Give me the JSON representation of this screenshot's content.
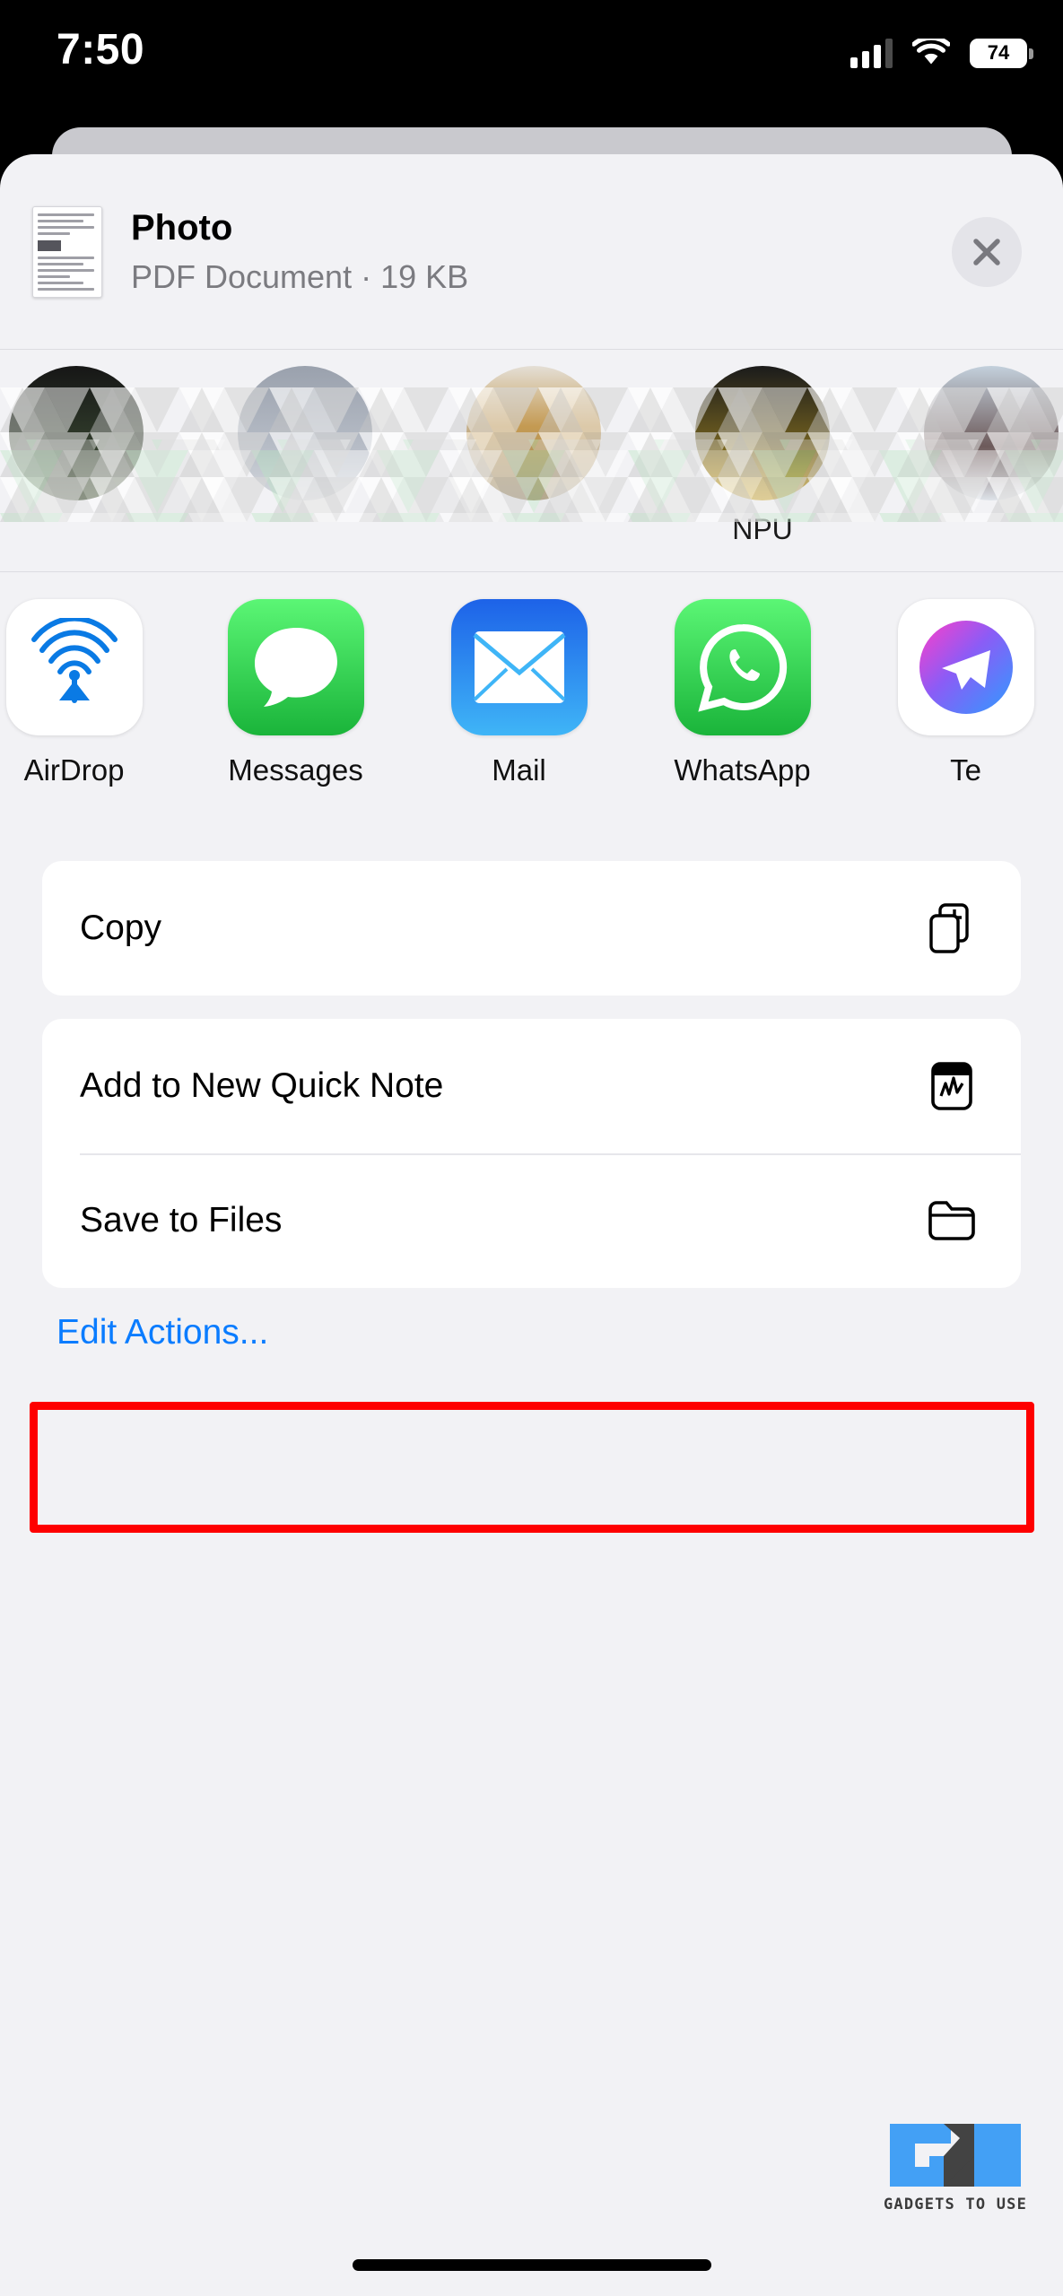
{
  "status_bar": {
    "time": "7:50",
    "battery_level": "74",
    "signal_icon": "cellular-signal-icon",
    "wifi_icon": "wifi-icon",
    "battery_icon": "battery-icon"
  },
  "share_sheet": {
    "document": {
      "title": "Photo",
      "subtitle": "PDF Document · 19 KB",
      "thumbnail_name": "pdf-page-thumbnail"
    },
    "close_label": "Close",
    "contacts": [
      {
        "name": "",
        "censored": true
      },
      {
        "name": "",
        "censored": true
      },
      {
        "name": "",
        "censored": true
      },
      {
        "name": "NPU",
        "censored": true
      },
      {
        "name": "",
        "censored": true
      }
    ],
    "apps": [
      {
        "label": "AirDrop",
        "icon": "airdrop-icon"
      },
      {
        "label": "Messages",
        "icon": "messages-icon"
      },
      {
        "label": "Mail",
        "icon": "mail-icon"
      },
      {
        "label": "WhatsApp",
        "icon": "whatsapp-icon"
      },
      {
        "label": "Te",
        "icon": "telegram-icon"
      }
    ],
    "actions_primary": [
      {
        "label": "Copy",
        "icon": "copy-icon"
      }
    ],
    "actions_secondary": [
      {
        "label": "Add to New Quick Note",
        "icon": "quick-note-icon"
      },
      {
        "label": "Save to Files",
        "icon": "folder-icon",
        "highlighted": true
      }
    ],
    "edit_actions_label": "Edit Actions...",
    "highlight_color": "#fe0000",
    "link_color": "#0a7cff"
  },
  "watermark": {
    "logo_text": "GU",
    "text": "GADGETS TO USE"
  }
}
